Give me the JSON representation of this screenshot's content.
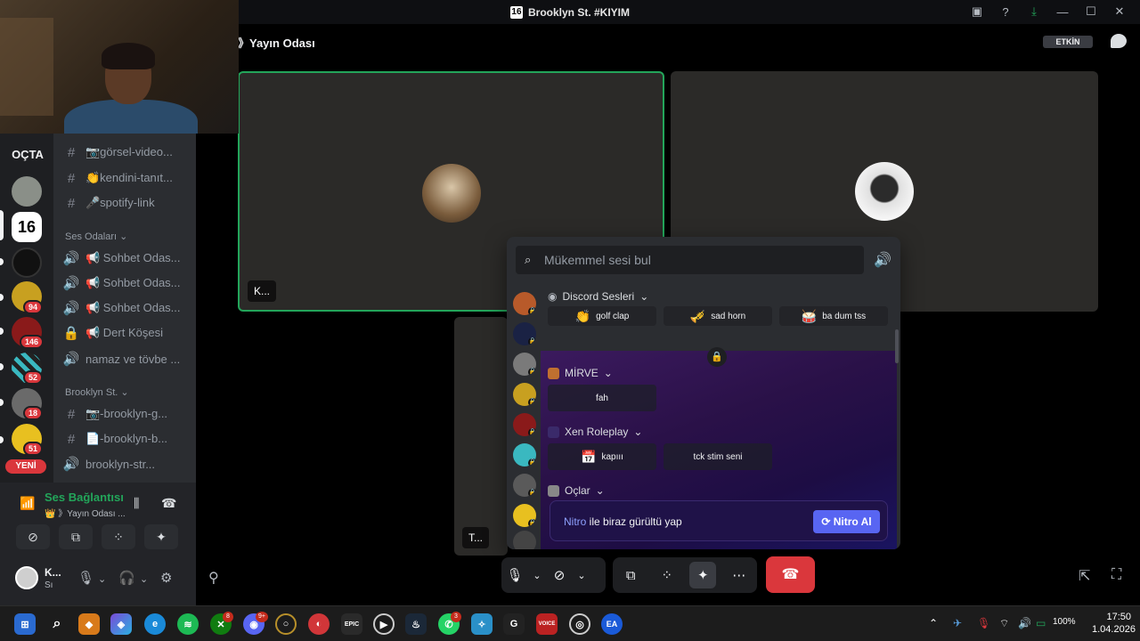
{
  "window": {
    "server_badge": "16",
    "title": "Brooklyn St. #KIYIM"
  },
  "rail": {
    "header": "OÇTA",
    "badges": [
      "94",
      "146",
      "52",
      "18",
      "51"
    ],
    "new_label": "YENİ"
  },
  "channels": {
    "top": [
      {
        "icon": "hashtag-icon",
        "label": "📷görsel-video..."
      },
      {
        "icon": "hashtag-icon",
        "label": "👏kendini-tanıt..."
      },
      {
        "icon": "hashtag-icon",
        "label": "🎤spotify-link"
      }
    ],
    "voice_category": "Ses Odaları",
    "voice": [
      {
        "label": "📢 Sohbet Odas..."
      },
      {
        "label": "📢 Sohbet Odas..."
      },
      {
        "label": "📢 Sohbet Odas..."
      },
      {
        "label": "📢 Dert Köşesi"
      },
      {
        "label": "namaz ve tövbe ..."
      }
    ],
    "brooklyn_category": "Brooklyn St.",
    "brooklyn": [
      {
        "label": "📷-brooklyn-g..."
      },
      {
        "label": "📄-brooklyn-b..."
      },
      {
        "label": "brooklyn-str..."
      }
    ]
  },
  "voice_panel": {
    "status": "Ses Bağlantısı K",
    "room": "👑 》Yayın Odası ..."
  },
  "user": {
    "name": "K...",
    "status": "Sı"
  },
  "stage": {
    "breadcrumb": "》Yayın Odası",
    "active_badge": "ETKİN",
    "tile1_label": "K...",
    "tile3_label": "T..."
  },
  "soundboard": {
    "search_placeholder": "Mükemmel sesi bul",
    "sections": {
      "discord": "Discord Sesleri",
      "mirve": "MİRVE",
      "xen": "Xen Roleplay",
      "oclar": "Oçlar"
    },
    "sounds": {
      "golf_clap": "golf clap",
      "sad_horn": "sad horn",
      "ba_dum_tss": "ba dum tss",
      "fah": "fah",
      "kapiii": "kapııı",
      "tck": "tck stim seni"
    },
    "nitro_word": "Nitro",
    "nitro_text": " ile biraz gürültü yap",
    "nitro_button": "Nitro Al"
  },
  "taskbar": {
    "badges": [
      "8",
      "9+",
      "3"
    ],
    "battery": "100%",
    "time": "17:50",
    "date": "1.04.2026"
  },
  "colors": {
    "accent": "#5865f2",
    "danger": "#da373c",
    "online": "#23a55a"
  }
}
